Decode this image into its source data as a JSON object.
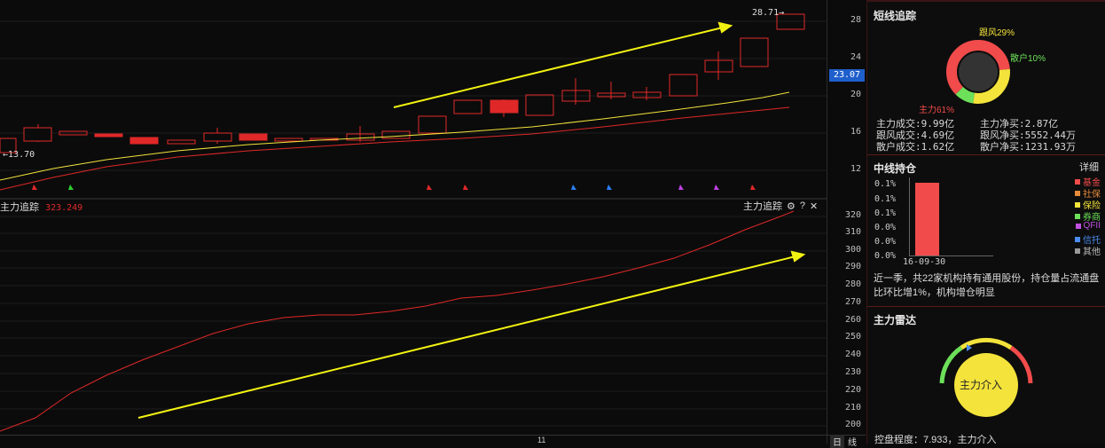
{
  "main_chart": {
    "max_label": "28.71",
    "min_label": "13.70",
    "axis_ticks": [
      "28",
      "24",
      "20",
      "16",
      "12"
    ],
    "current_price": "23.07",
    "current_color": "#1f5fcc"
  },
  "sub_chart": {
    "indicator_name": "主力追踪",
    "indicator_value": "323.249",
    "title_right": "主力追踪",
    "gear_icon": "⚙",
    "help_icon": "?",
    "close_icon": "✕",
    "axis_ticks": [
      "320",
      "310",
      "300",
      "290",
      "280",
      "270",
      "260",
      "250",
      "240",
      "230",
      "220",
      "210",
      "200"
    ]
  },
  "bottom": {
    "date_label": "11",
    "period_day": "日",
    "period_line": "线"
  },
  "short_track": {
    "title": "短线追踪",
    "donut_labels": {
      "follow": "跟风29%",
      "retail": "散户10%",
      "main": "主力61%"
    },
    "colors": {
      "main": "#f24b4b",
      "follow": "#f3e33b",
      "retail": "#6de05a"
    },
    "stats": [
      {
        "left": "主力成交:9.99亿",
        "right": "主力净买:2.87亿"
      },
      {
        "left": "跟风成交:4.69亿",
        "right": "跟风净买:5552.44万"
      },
      {
        "left": "散户成交:1.62亿",
        "right": "散户净买:1231.93万"
      }
    ]
  },
  "mid_hold": {
    "title": "中线持仓",
    "detail_label": "详细",
    "y_labels": [
      "0.1%",
      "0.1%",
      "0.1%",
      "0.0%",
      "0.0%",
      "0.0%"
    ],
    "x_label": "16-09-30",
    "legend": [
      {
        "label": "基金",
        "color": "#f24b4b"
      },
      {
        "label": "社保",
        "color": "#e88b3a"
      },
      {
        "label": "保险",
        "color": "#f3e33b"
      },
      {
        "label": "券商",
        "color": "#6de05a"
      },
      {
        "label": "QFII",
        "color": "#c050e0"
      },
      {
        "label": "信托",
        "color": "#4a8cf0"
      },
      {
        "label": "其他",
        "color": "#999999"
      }
    ],
    "description": "近一季，共22家机构持有通用股份，持仓量占流通盘比环比增1%，机构增仓明显"
  },
  "radar": {
    "title": "主力雷达",
    "center_label": "主力介入",
    "footer": "控盘程度：7.933，主力介入",
    "colors": {
      "low": "#6de05a",
      "mid": "#f3e33b",
      "high": "#f24b4b"
    }
  }
}
